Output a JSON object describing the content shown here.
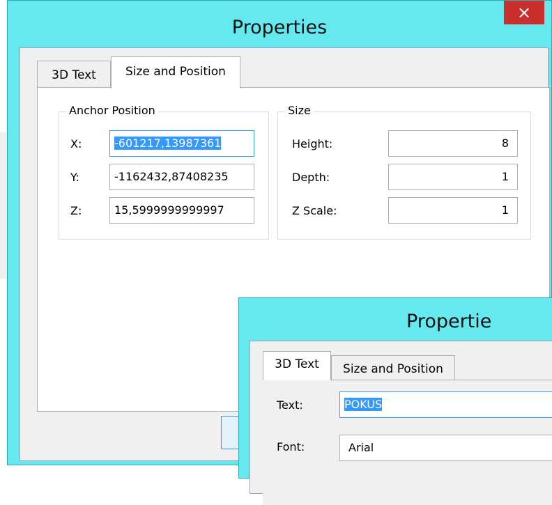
{
  "dialog_back": {
    "title": "Properties",
    "close_label": "×",
    "tabs": [
      "3D Text",
      "Size and Position"
    ],
    "anchor_group": "Anchor Position",
    "anchor": [
      {
        "label": "X:",
        "value": "-601217,13987361"
      },
      {
        "label": "Y:",
        "value": "-1162432,87408235"
      },
      {
        "label": "Z:",
        "value": "15,5999999999997"
      }
    ],
    "size_group": "Size",
    "size": [
      {
        "label": "Height:",
        "value": "8"
      },
      {
        "label": "Depth:",
        "value": "1"
      },
      {
        "label": "Z Scale:",
        "value": "1"
      }
    ]
  },
  "dialog_front": {
    "title": "Propertie",
    "tabs": [
      "3D Text",
      "Size and Position"
    ],
    "text_label": "Text:",
    "text_value": "POKUS",
    "font_label": "Font:",
    "font_value": "Arial"
  },
  "colors": {
    "titlebar": "#66e8ef",
    "close": "#c9302c",
    "selection": "#3399ff"
  }
}
